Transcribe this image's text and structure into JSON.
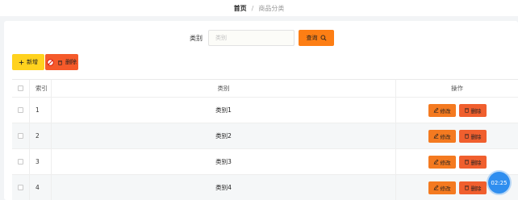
{
  "breadcrumb": {
    "home": "首页",
    "separator": "/",
    "current": "商品分类"
  },
  "search": {
    "label": "类别",
    "placeholder": "类别",
    "query_label": "查询"
  },
  "toolbar": {
    "add_label": "新增",
    "delete_label": "删除"
  },
  "table": {
    "headers": {
      "index": "索引",
      "category": "类别",
      "actions": "操作"
    },
    "rows": [
      {
        "index": "1",
        "category": "类别1",
        "edit_label": "修改",
        "delete_label": "删除"
      },
      {
        "index": "2",
        "category": "类别2",
        "edit_label": "修改",
        "delete_label": "删除"
      },
      {
        "index": "3",
        "category": "类别3",
        "edit_label": "修改",
        "delete_label": "删除"
      },
      {
        "index": "4",
        "category": "类别4",
        "edit_label": "修改",
        "delete_label": "删除"
      }
    ]
  },
  "clock": {
    "time": "02:25"
  },
  "colors": {
    "query": "#fd7e14",
    "add": "#ffd21e",
    "delete": "#f55a2a",
    "clock": "#2f8eef"
  },
  "icons": {
    "add": "plus-icon",
    "delete": "trash-icon",
    "query": "search-icon",
    "edit": "pencil-icon",
    "ban": "ban-icon"
  }
}
